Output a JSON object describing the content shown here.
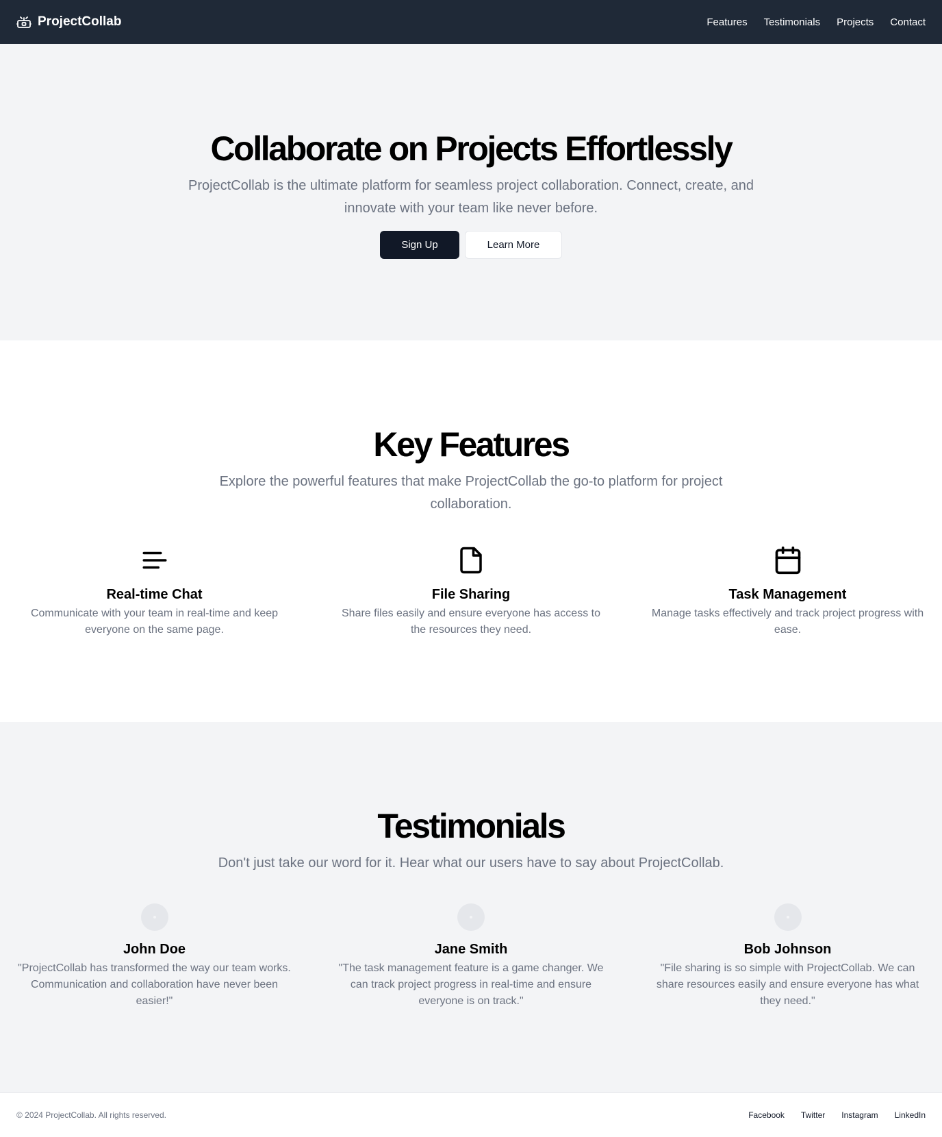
{
  "header": {
    "brand": "ProjectCollab",
    "logo_icon": "bot-icon",
    "nav": [
      "Features",
      "Testimonials",
      "Projects",
      "Contact"
    ]
  },
  "hero": {
    "title": "Collaborate on Projects Effortlessly",
    "subtitle": "ProjectCollab is the ultimate platform for seamless project collaboration. Connect, create, and innovate with your team like never before.",
    "primary_button": "Sign Up",
    "secondary_button": "Learn More"
  },
  "features": {
    "title": "Key Features",
    "subtitle": "Explore the powerful features that make ProjectCollab the go-to platform for project collaboration.",
    "items": [
      {
        "icon": "text-lines-icon",
        "title": "Real-time Chat",
        "description": "Communicate with your team in real-time and keep everyone on the same page."
      },
      {
        "icon": "file-icon",
        "title": "File Sharing",
        "description": "Share files easily and ensure everyone has access to the resources they need."
      },
      {
        "icon": "calendar-icon",
        "title": "Task Management",
        "description": "Manage tasks effectively and track project progress with ease."
      }
    ]
  },
  "testimonials": {
    "title": "Testimonials",
    "subtitle": "Don't just take our word for it. Hear what our users have to say about ProjectCollab.",
    "items": [
      {
        "name": "John Doe",
        "quote": "\"ProjectCollab has transformed the way our team works. Communication and collaboration have never been easier!\""
      },
      {
        "name": "Jane Smith",
        "quote": "\"The task management feature is a game changer. We can track project progress in real-time and ensure everyone is on track.\""
      },
      {
        "name": "Bob Johnson",
        "quote": "\"File sharing is so simple with ProjectCollab. We can share resources easily and ensure everyone has what they need.\""
      }
    ]
  },
  "footer": {
    "copyright": "© 2024 ProjectCollab. All rights reserved.",
    "links": [
      "Facebook",
      "Twitter",
      "Instagram",
      "LinkedIn"
    ]
  },
  "colors": {
    "nav_background": "#1f2937",
    "section_gray": "#f3f4f6",
    "primary_button": "#111827",
    "muted_text": "#6b7280"
  }
}
